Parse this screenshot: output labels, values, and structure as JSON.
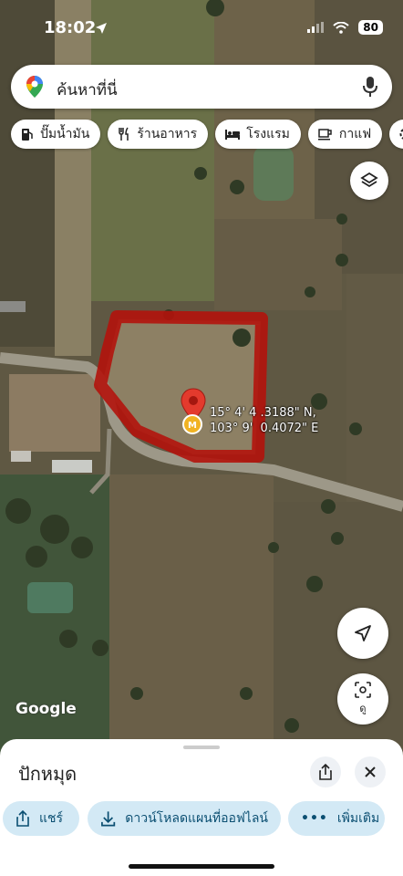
{
  "status_bar": {
    "time": "18:02",
    "battery": "80"
  },
  "search": {
    "placeholder": "ค้นหาที่นี่"
  },
  "chips": [
    {
      "label": "ปั๊มน้ำมัน",
      "icon": "gas-station-icon"
    },
    {
      "label": "ร้านอาหาร",
      "icon": "restaurant-icon"
    },
    {
      "label": "โรงแรม",
      "icon": "hotel-icon"
    },
    {
      "label": "กาแฟ",
      "icon": "coffee-icon"
    }
  ],
  "map": {
    "marker_coords_line1": "15° 4' 4 .3188\" N,",
    "marker_coords_line2": "103° 9'  0.4072\" E",
    "attribution": "Google",
    "outline_color": "#b3130c",
    "pin_color": "#e33a2d"
  },
  "controls": {
    "lens_label": "ดู"
  },
  "bottom_sheet": {
    "title": "ปักหมุด",
    "actions": [
      {
        "label": "แชร์",
        "icon": "share-icon"
      },
      {
        "label": "ดาวน์โหลดแผนที่ออฟไลน์",
        "icon": "download-icon"
      },
      {
        "label": "เพิ่มเติม",
        "icon": "more-icon"
      }
    ]
  }
}
